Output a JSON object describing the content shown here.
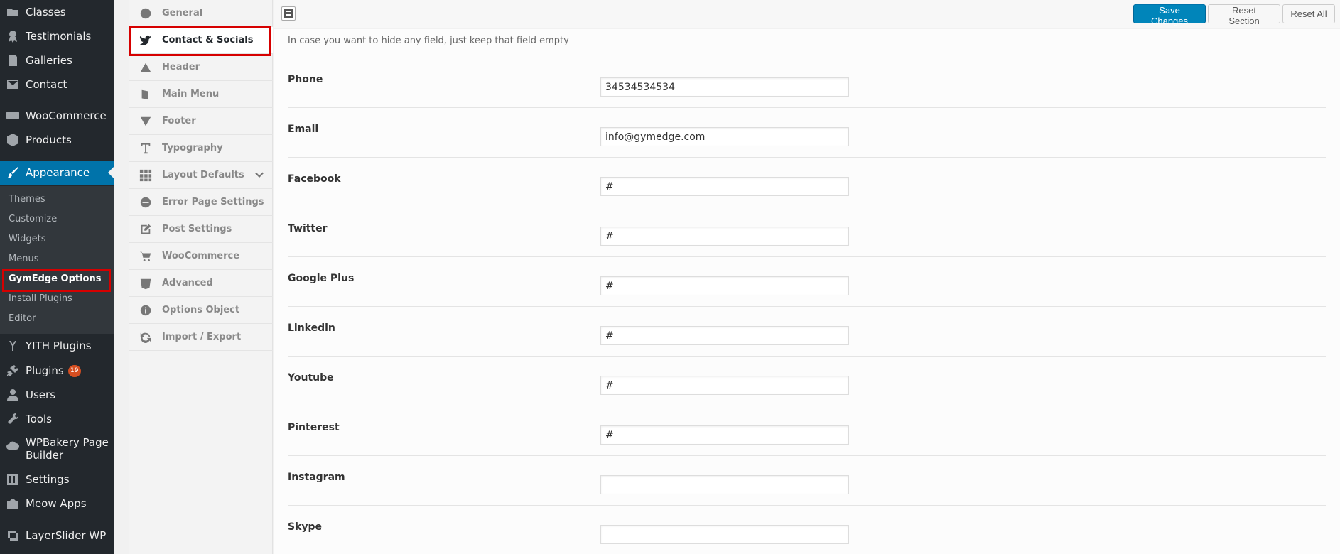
{
  "wp_menu": {
    "items": [
      {
        "label": "Classes",
        "icon": "folder-icon"
      },
      {
        "label": "Testimonials",
        "icon": "award-icon"
      },
      {
        "label": "Galleries",
        "icon": "document-icon"
      },
      {
        "label": "Contact",
        "icon": "mail-icon"
      },
      {
        "label": "WooCommerce",
        "icon": "woo-icon"
      },
      {
        "label": "Products",
        "icon": "cube-icon"
      },
      {
        "label": "Appearance",
        "icon": "paintbrush-icon"
      },
      {
        "label": "YITH Plugins",
        "icon": "yith-icon"
      },
      {
        "label": "Plugins",
        "icon": "plug-icon",
        "badge": "19"
      },
      {
        "label": "Users",
        "icon": "user-icon"
      },
      {
        "label": "Tools",
        "icon": "wrench-icon"
      },
      {
        "label": "WPBakery Page Builder",
        "icon": "cloud-icon"
      },
      {
        "label": "Settings",
        "icon": "sliders-icon"
      },
      {
        "label": "Meow Apps",
        "icon": "camera-icon"
      },
      {
        "label": "LayerSlider WP",
        "icon": "layers-icon"
      }
    ],
    "submenu": [
      "Themes",
      "Customize",
      "Widgets",
      "Menus",
      "GymEdge Options",
      "Install Plugins",
      "Editor"
    ]
  },
  "options_nav": [
    {
      "label": "General",
      "icon": "globe-icon"
    },
    {
      "label": "Contact & Socials",
      "icon": "twitter-icon"
    },
    {
      "label": "Header",
      "icon": "triangle-up-icon"
    },
    {
      "label": "Main Menu",
      "icon": "book-icon"
    },
    {
      "label": "Footer",
      "icon": "triangle-down-icon"
    },
    {
      "label": "Typography",
      "icon": "text-icon"
    },
    {
      "label": "Layout Defaults",
      "icon": "grid-icon"
    },
    {
      "label": "Error Page Settings",
      "icon": "minus-circle-icon"
    },
    {
      "label": "Post Settings",
      "icon": "edit-icon"
    },
    {
      "label": "WooCommerce",
      "icon": "cart-icon"
    },
    {
      "label": "Advanced",
      "icon": "css-icon"
    },
    {
      "label": "Options Object",
      "icon": "info-icon"
    },
    {
      "label": "Import / Export",
      "icon": "refresh-icon"
    }
  ],
  "toolbar": {
    "save_label": "Save Changes",
    "reset_section_label": "Reset Section",
    "reset_all_label": "Reset All"
  },
  "section": {
    "hint": "In case you want to hide any field, just keep that field empty",
    "fields": [
      {
        "label": "Phone",
        "value": "34534534534"
      },
      {
        "label": "Email",
        "value": "info@gymedge.com"
      },
      {
        "label": "Facebook",
        "value": "#"
      },
      {
        "label": "Twitter",
        "value": "#"
      },
      {
        "label": "Google Plus",
        "value": "#"
      },
      {
        "label": "Linkedin",
        "value": "#"
      },
      {
        "label": "Youtube",
        "value": "#"
      },
      {
        "label": "Pinterest",
        "value": "#"
      },
      {
        "label": "Instagram",
        "value": ""
      },
      {
        "label": "Skype",
        "value": ""
      }
    ]
  }
}
